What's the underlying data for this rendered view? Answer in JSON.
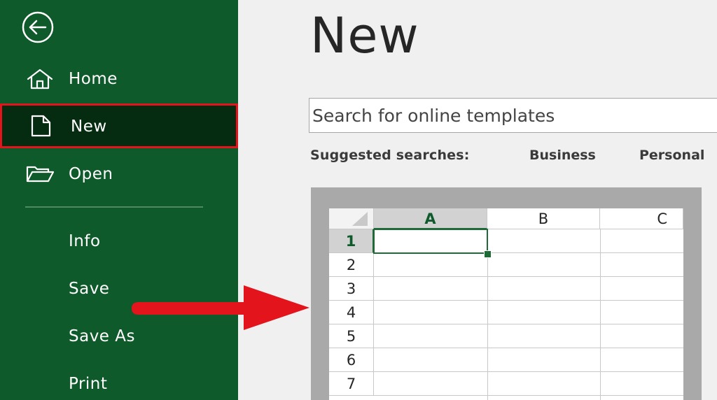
{
  "sidebar": {
    "back_icon": "arrow-left-circle-icon",
    "items": [
      {
        "label": "Home",
        "icon": "home-icon"
      },
      {
        "label": "New",
        "icon": "new-document-icon",
        "selected": true
      },
      {
        "label": "Open",
        "icon": "folder-open-icon"
      }
    ],
    "text_items": [
      "Info",
      "Save",
      "Save As",
      "Print"
    ],
    "colors": {
      "background": "#0f5a2a",
      "selected_background": "#052c10",
      "highlight_border": "#e3141b"
    }
  },
  "main": {
    "title": "New",
    "search": {
      "placeholder": "Search for online templates",
      "icon": "none"
    },
    "suggested": {
      "label": "Suggested searches:",
      "items": [
        "Business",
        "Personal"
      ]
    },
    "template": {
      "columns": [
        "A",
        "B",
        "C"
      ],
      "rows": [
        "1",
        "2",
        "3",
        "4",
        "5",
        "6",
        "7"
      ],
      "active_cell": "A1",
      "accent_color": "#1e6b38"
    }
  },
  "annotation": {
    "arrow_color": "#e3141b",
    "arrow_icon": "red-arrow-right-icon"
  }
}
